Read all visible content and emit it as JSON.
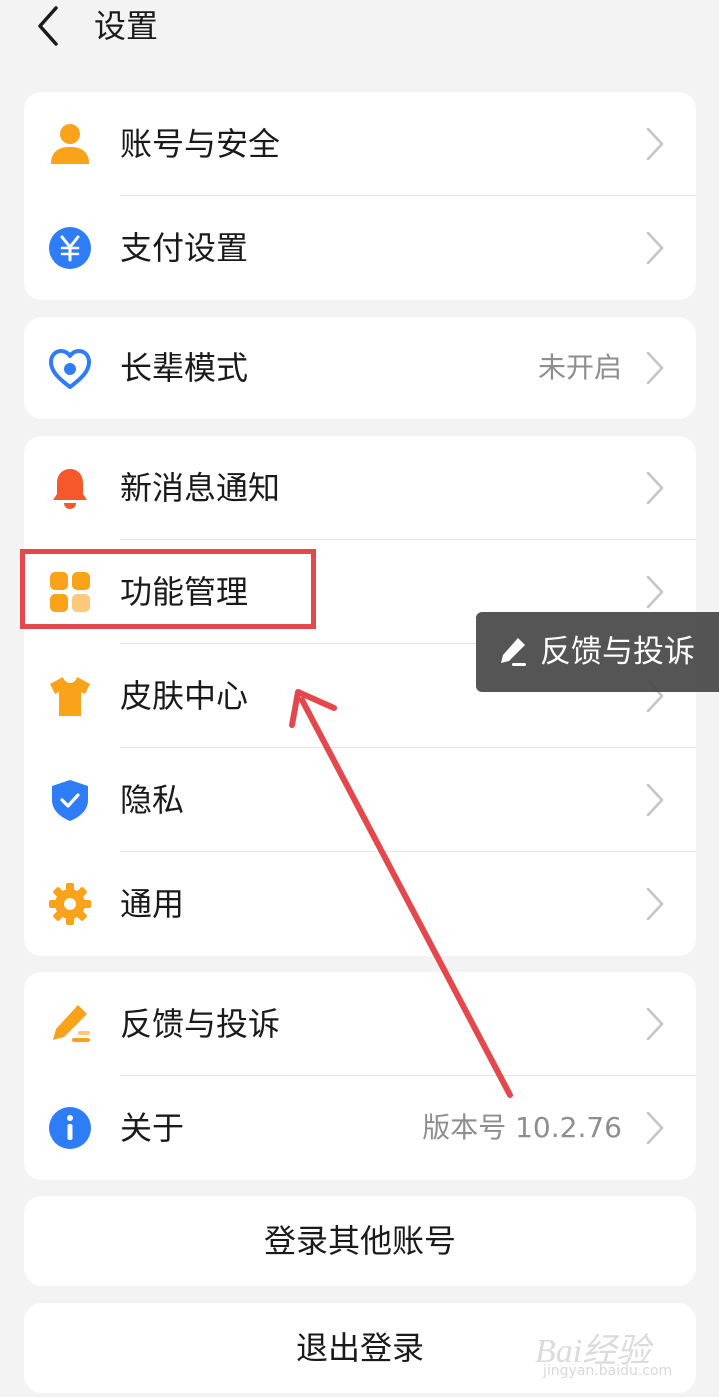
{
  "header": {
    "back_icon": "chevron-left-icon",
    "title": "设置"
  },
  "group1": {
    "items": [
      {
        "label": "账号与安全",
        "icon": "user-icon",
        "color": "#f9a21a"
      },
      {
        "label": "支付设置",
        "icon": "yuan-icon",
        "color": "#2e7cf6"
      }
    ]
  },
  "group2": {
    "items": [
      {
        "label": "长辈模式",
        "value": "未开启",
        "icon": "heart-icon",
        "color": "#2e7cf6"
      }
    ]
  },
  "group3": {
    "items": [
      {
        "label": "新消息通知",
        "icon": "bell-icon",
        "color": "#f5582a"
      },
      {
        "label": "功能管理",
        "icon": "grid-icon",
        "color": "#f9a21a"
      },
      {
        "label": "皮肤中心",
        "icon": "tshirt-icon",
        "color": "#f9a21a"
      },
      {
        "label": "隐私",
        "icon": "shield-icon",
        "color": "#2e7cf6"
      },
      {
        "label": "通用",
        "icon": "gear-icon",
        "color": "#f9a21a"
      }
    ]
  },
  "group4": {
    "items": [
      {
        "label": "反馈与投诉",
        "icon": "pencil-icon",
        "color": "#f9a21a"
      },
      {
        "label": "关于",
        "value": "版本号 10.2.76",
        "icon": "info-icon",
        "color": "#2e7cf6"
      }
    ]
  },
  "buttons": {
    "switch_account": "登录其他账号",
    "logout": "退出登录"
  },
  "floating": {
    "feedback_label": "反馈与投诉",
    "feedback_icon": "pencil-icon"
  },
  "watermark": {
    "main": "Bai经验",
    "sub": "jingyan.baidu.com"
  },
  "annotation": {
    "highlight_color": "#e4484d"
  }
}
